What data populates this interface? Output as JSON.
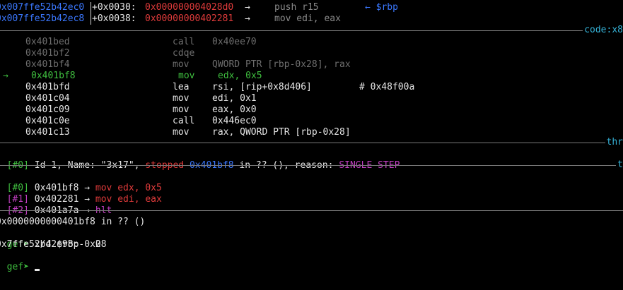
{
  "stack": [
    {
      "addr": "0x007ffe52b42ec0",
      "offset": "+0x0030:",
      "value": "0x000000004028d0",
      "arrow": "→",
      "instr": "push r15",
      "note": "← $rbp"
    },
    {
      "addr": "0x007ffe52b42ec8",
      "offset": "+0x0038:",
      "value": "0x00000000402281",
      "arrow": "→",
      "instr": "mov edi, eax",
      "note": ""
    }
  ],
  "code_label": "code:x8",
  "code": [
    {
      "marker": "",
      "addr": "0x401bed",
      "mnem": "call",
      "ops": "0x40ee70",
      "comment": "",
      "state": "past"
    },
    {
      "marker": "",
      "addr": "0x401bf2",
      "mnem": "cdqe",
      "ops": "",
      "comment": "",
      "state": "past"
    },
    {
      "marker": "",
      "addr": "0x401bf4",
      "mnem": "mov",
      "ops": "QWORD PTR [rbp-0x28], rax",
      "comment": "",
      "state": "past"
    },
    {
      "marker": "→",
      "addr": "0x401bf8",
      "mnem": "mov",
      "ops": "edx, 0x5",
      "comment": "",
      "state": "current"
    },
    {
      "marker": "",
      "addr": "0x401bfd",
      "mnem": "lea",
      "ops": "rsi, [rip+0x8d406]",
      "comment": "# 0x48f00a",
      "state": "next"
    },
    {
      "marker": "",
      "addr": "0x401c04",
      "mnem": "mov",
      "ops": "edi, 0x1",
      "comment": "",
      "state": "next"
    },
    {
      "marker": "",
      "addr": "0x401c09",
      "mnem": "mov",
      "ops": "eax, 0x0",
      "comment": "",
      "state": "next"
    },
    {
      "marker": "",
      "addr": "0x401c0e",
      "mnem": "call",
      "ops": "0x446ec0",
      "comment": "",
      "state": "next"
    },
    {
      "marker": "",
      "addr": "0x401c13",
      "mnem": "mov",
      "ops": "rax, QWORD PTR [rbp-0x28]",
      "comment": "",
      "state": "next"
    }
  ],
  "threads_label": "thr",
  "thread": {
    "idx": "[#0]",
    "id_text": " Id 1, Name: \"3x17\", ",
    "state": "stopped",
    "addr": "0x401bf8",
    "rest": " in ?? (), reason: ",
    "reason": "SINGLE STEP"
  },
  "trace_label": "t",
  "trace": [
    {
      "idx": "[#0]",
      "addr": "0x401bf8",
      "arrow": "→",
      "instr": "mov edx, 0x5"
    },
    {
      "idx": "[#1]",
      "addr": "0x402281",
      "arrow": "→",
      "instr": "mov edi, eax"
    },
    {
      "idx": "[#2]",
      "addr": "0x401a7a",
      "arrow": "→",
      "instr": "hlt"
    }
  ],
  "console": {
    "location": "0x0000000000401bf8 in ?? ()",
    "prompt": "gef➤",
    "cmd1": "x/d $rbp-0x28",
    "result": "0x7ffe52b42e98:   0",
    "prompt2": "gef➤"
  }
}
